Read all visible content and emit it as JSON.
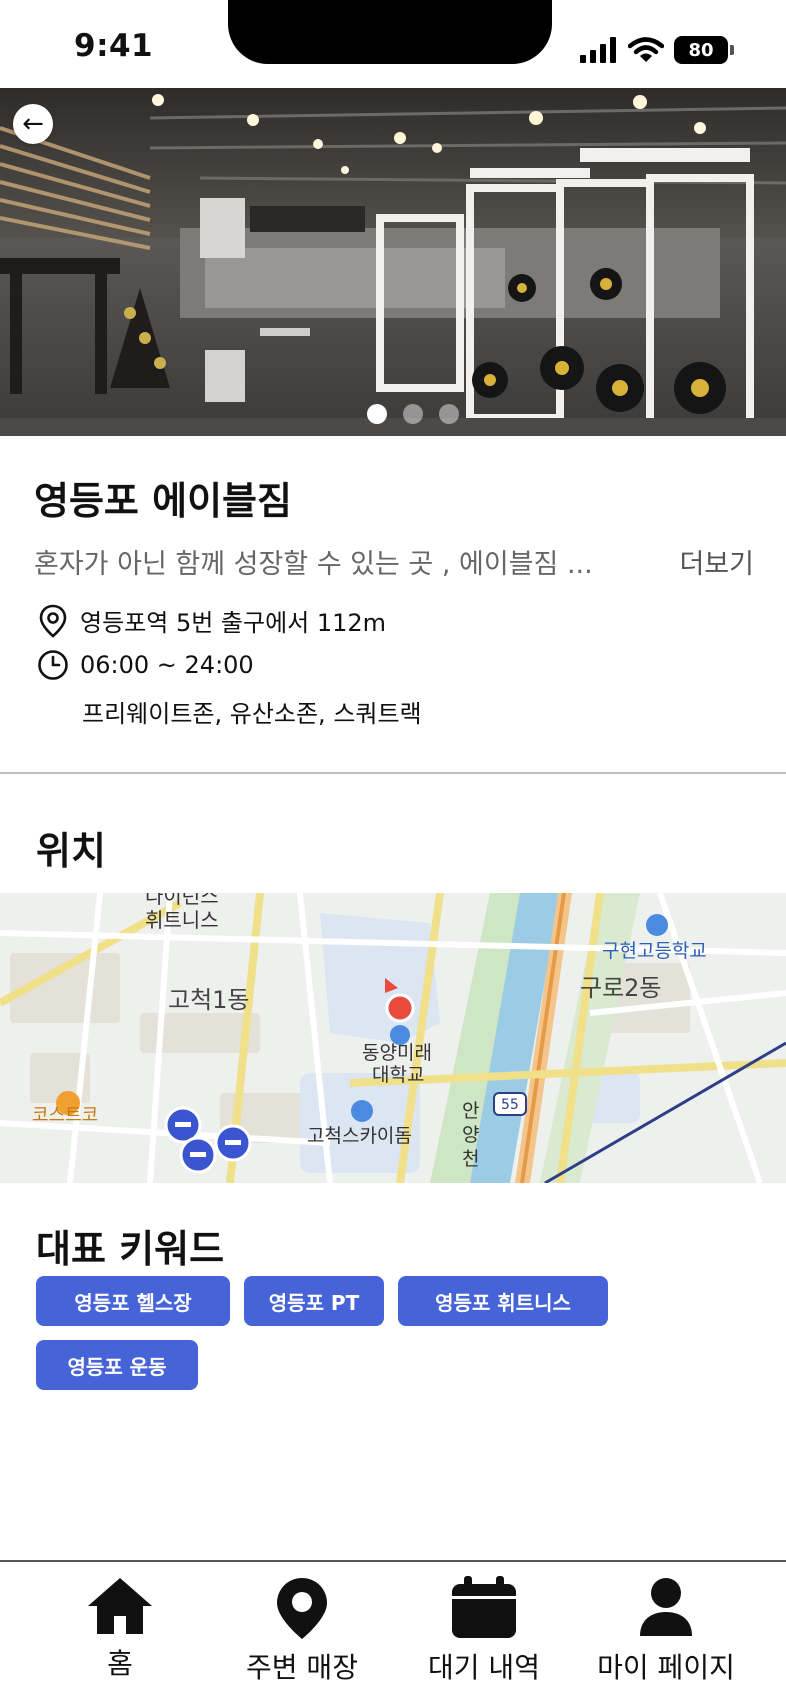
{
  "status_bar": {
    "time": "9:41",
    "battery": "80"
  },
  "hero": {
    "back_icon": "arrow-left-icon",
    "page_count": 3,
    "active_page": 1
  },
  "gym": {
    "name": "영등포 에이블짐",
    "description": "혼자가 아닌 함께 성장할 수 있는 곳 , 에이블짐 ...",
    "more_label": "더보기",
    "location": "영등포역 5번 출구에서 112m",
    "hours": "06:00 ~ 24:00",
    "facilities": "프리웨이트존, 유산소존, 스쿼트랙"
  },
  "location_section": {
    "title": "위치",
    "map_labels": {
      "fitness_a": "다이런스",
      "fitness_b": "휘트니스",
      "gocheok1": "고척1동",
      "dongyang_a": "동양미래",
      "dongyang_b": "대학교",
      "costco": "코스트코",
      "skydome": "고척스카이돔",
      "anyang_a": "안",
      "anyang_b": "양",
      "anyang_c": "천",
      "guro2": "구로2동",
      "guhyeon": "구현고등학교",
      "road_no": "55"
    }
  },
  "keywords_section": {
    "title": "대표 키워드",
    "chips": [
      "영등포 헬스장",
      "영등포 PT",
      "영등포 휘트니스",
      "영등포 운동"
    ]
  },
  "tabbar": {
    "items": [
      {
        "label": "홈",
        "icon": "home-icon"
      },
      {
        "label": "주변 매장",
        "icon": "map-pin-icon"
      },
      {
        "label": "대기 내역",
        "icon": "calendar-icon"
      },
      {
        "label": "마이 페이지",
        "icon": "person-icon"
      }
    ]
  },
  "colors": {
    "accent": "#4763d8",
    "map_marker": "#e84a3c"
  }
}
